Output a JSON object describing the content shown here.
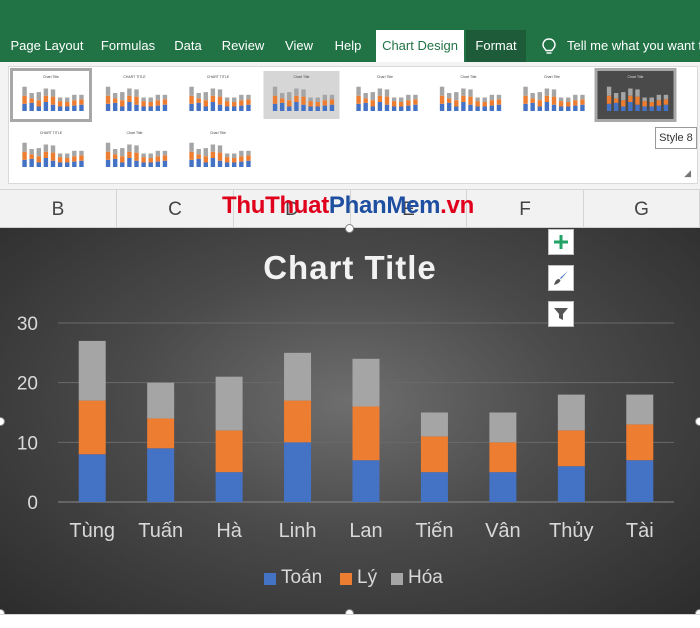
{
  "ribbon": {
    "tabs": [
      "Page Layout",
      "Formulas",
      "Data",
      "Review",
      "View",
      "Help",
      "Chart Design",
      "Format"
    ],
    "active_tab": "Chart Design",
    "tell_me": "Tell me what you want to d",
    "tooltip": "Style 8",
    "gallery_thumb_titles": [
      "Chart Title",
      "CHART TITLE",
      "CHART TITLE",
      "Chart Title",
      "Chart Title",
      "Chart Title",
      "Chart Title",
      "Chart Title",
      "CHART TITLE",
      "Chart Title",
      "Chart Title"
    ]
  },
  "columns": [
    "B",
    "C",
    "D",
    "E",
    "F",
    "G"
  ],
  "watermark": {
    "part1": "ThuThuat",
    "part2": "PhanMem",
    "part3": ".vn"
  },
  "colors": {
    "toan": "#4472c4",
    "ly": "#ed7d31",
    "hoa": "#a5a5a5",
    "excel_green": "#217346"
  },
  "chart_data": {
    "type": "bar",
    "stacked": true,
    "title": "Chart Title",
    "categories": [
      "Tùng",
      "Tuấn",
      "Hà",
      "Linh",
      "Lan",
      "Tiến",
      "Vân",
      "Thủy",
      "Tài"
    ],
    "series": [
      {
        "name": "Toán",
        "values": [
          8,
          9,
          5,
          10,
          7,
          5,
          5,
          6,
          7
        ]
      },
      {
        "name": "Lý",
        "values": [
          9,
          5,
          7,
          7,
          9,
          6,
          5,
          6,
          6
        ]
      },
      {
        "name": "Hóa",
        "values": [
          10,
          6,
          9,
          8,
          8,
          4,
          5,
          6,
          5
        ]
      }
    ],
    "ylim": [
      0,
      30
    ],
    "yticks": [
      "0",
      "10",
      "20",
      "30"
    ],
    "grid": true,
    "legend": "bottom"
  },
  "side_buttons": [
    "plus-icon",
    "brush-icon",
    "filter-icon"
  ]
}
